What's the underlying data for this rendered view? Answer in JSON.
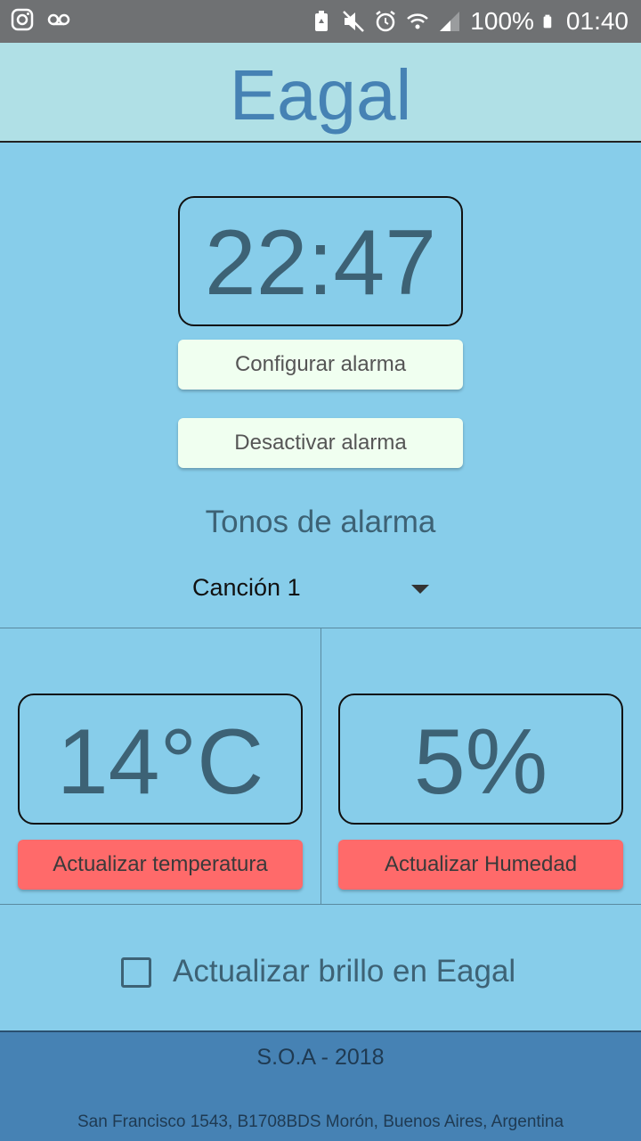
{
  "status_bar": {
    "battery": "100%",
    "time": "01:40",
    "icons": [
      "instagram-icon",
      "voicemail-icon",
      "battery-saver-icon",
      "mute-icon",
      "alarm-icon",
      "wifi-icon",
      "signal-icon",
      "battery-icon"
    ]
  },
  "app": {
    "title": "Eagal",
    "accent_color": "#4682b4"
  },
  "alarm": {
    "time": "22:47",
    "configure_label": "Configurar alarma",
    "deactivate_label": "Desactivar alarma",
    "tones_title": "Tonos de alarma",
    "selected_tone": "Canción 1"
  },
  "sensors": {
    "temperature": "14°C",
    "humidity": "5%",
    "update_temperature_label": "Actualizar temperatura",
    "update_humidity_label": "Actualizar Humedad",
    "button_color": "#ff6a6a"
  },
  "brightness": {
    "label": "Actualizar brillo en Eagal",
    "checked": false
  },
  "footer": {
    "title": "S.O.A - 2018",
    "address": "San Francisco 1543, B1708BDS Morón, Buenos Aires, Argentina"
  }
}
